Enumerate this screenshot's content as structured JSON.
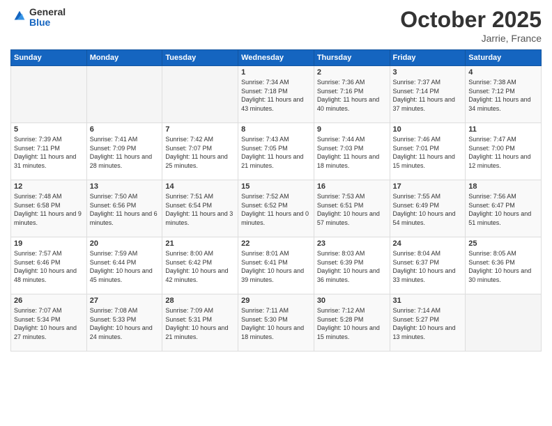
{
  "logo": {
    "line1": "General",
    "line2": "Blue"
  },
  "header": {
    "month": "October 2025",
    "location": "Jarrie, France"
  },
  "weekdays": [
    "Sunday",
    "Monday",
    "Tuesday",
    "Wednesday",
    "Thursday",
    "Friday",
    "Saturday"
  ],
  "weeks": [
    [
      {
        "day": "",
        "info": ""
      },
      {
        "day": "",
        "info": ""
      },
      {
        "day": "",
        "info": ""
      },
      {
        "day": "1",
        "info": "Sunrise: 7:34 AM\nSunset: 7:18 PM\nDaylight: 11 hours\nand 43 minutes."
      },
      {
        "day": "2",
        "info": "Sunrise: 7:36 AM\nSunset: 7:16 PM\nDaylight: 11 hours\nand 40 minutes."
      },
      {
        "day": "3",
        "info": "Sunrise: 7:37 AM\nSunset: 7:14 PM\nDaylight: 11 hours\nand 37 minutes."
      },
      {
        "day": "4",
        "info": "Sunrise: 7:38 AM\nSunset: 7:12 PM\nDaylight: 11 hours\nand 34 minutes."
      }
    ],
    [
      {
        "day": "5",
        "info": "Sunrise: 7:39 AM\nSunset: 7:11 PM\nDaylight: 11 hours\nand 31 minutes."
      },
      {
        "day": "6",
        "info": "Sunrise: 7:41 AM\nSunset: 7:09 PM\nDaylight: 11 hours\nand 28 minutes."
      },
      {
        "day": "7",
        "info": "Sunrise: 7:42 AM\nSunset: 7:07 PM\nDaylight: 11 hours\nand 25 minutes."
      },
      {
        "day": "8",
        "info": "Sunrise: 7:43 AM\nSunset: 7:05 PM\nDaylight: 11 hours\nand 21 minutes."
      },
      {
        "day": "9",
        "info": "Sunrise: 7:44 AM\nSunset: 7:03 PM\nDaylight: 11 hours\nand 18 minutes."
      },
      {
        "day": "10",
        "info": "Sunrise: 7:46 AM\nSunset: 7:01 PM\nDaylight: 11 hours\nand 15 minutes."
      },
      {
        "day": "11",
        "info": "Sunrise: 7:47 AM\nSunset: 7:00 PM\nDaylight: 11 hours\nand 12 minutes."
      }
    ],
    [
      {
        "day": "12",
        "info": "Sunrise: 7:48 AM\nSunset: 6:58 PM\nDaylight: 11 hours\nand 9 minutes."
      },
      {
        "day": "13",
        "info": "Sunrise: 7:50 AM\nSunset: 6:56 PM\nDaylight: 11 hours\nand 6 minutes."
      },
      {
        "day": "14",
        "info": "Sunrise: 7:51 AM\nSunset: 6:54 PM\nDaylight: 11 hours\nand 3 minutes."
      },
      {
        "day": "15",
        "info": "Sunrise: 7:52 AM\nSunset: 6:52 PM\nDaylight: 11 hours\nand 0 minutes."
      },
      {
        "day": "16",
        "info": "Sunrise: 7:53 AM\nSunset: 6:51 PM\nDaylight: 10 hours\nand 57 minutes."
      },
      {
        "day": "17",
        "info": "Sunrise: 7:55 AM\nSunset: 6:49 PM\nDaylight: 10 hours\nand 54 minutes."
      },
      {
        "day": "18",
        "info": "Sunrise: 7:56 AM\nSunset: 6:47 PM\nDaylight: 10 hours\nand 51 minutes."
      }
    ],
    [
      {
        "day": "19",
        "info": "Sunrise: 7:57 AM\nSunset: 6:46 PM\nDaylight: 10 hours\nand 48 minutes."
      },
      {
        "day": "20",
        "info": "Sunrise: 7:59 AM\nSunset: 6:44 PM\nDaylight: 10 hours\nand 45 minutes."
      },
      {
        "day": "21",
        "info": "Sunrise: 8:00 AM\nSunset: 6:42 PM\nDaylight: 10 hours\nand 42 minutes."
      },
      {
        "day": "22",
        "info": "Sunrise: 8:01 AM\nSunset: 6:41 PM\nDaylight: 10 hours\nand 39 minutes."
      },
      {
        "day": "23",
        "info": "Sunrise: 8:03 AM\nSunset: 6:39 PM\nDaylight: 10 hours\nand 36 minutes."
      },
      {
        "day": "24",
        "info": "Sunrise: 8:04 AM\nSunset: 6:37 PM\nDaylight: 10 hours\nand 33 minutes."
      },
      {
        "day": "25",
        "info": "Sunrise: 8:05 AM\nSunset: 6:36 PM\nDaylight: 10 hours\nand 30 minutes."
      }
    ],
    [
      {
        "day": "26",
        "info": "Sunrise: 7:07 AM\nSunset: 5:34 PM\nDaylight: 10 hours\nand 27 minutes."
      },
      {
        "day": "27",
        "info": "Sunrise: 7:08 AM\nSunset: 5:33 PM\nDaylight: 10 hours\nand 24 minutes."
      },
      {
        "day": "28",
        "info": "Sunrise: 7:09 AM\nSunset: 5:31 PM\nDaylight: 10 hours\nand 21 minutes."
      },
      {
        "day": "29",
        "info": "Sunrise: 7:11 AM\nSunset: 5:30 PM\nDaylight: 10 hours\nand 18 minutes."
      },
      {
        "day": "30",
        "info": "Sunrise: 7:12 AM\nSunset: 5:28 PM\nDaylight: 10 hours\nand 15 minutes."
      },
      {
        "day": "31",
        "info": "Sunrise: 7:14 AM\nSunset: 5:27 PM\nDaylight: 10 hours\nand 13 minutes."
      },
      {
        "day": "",
        "info": ""
      }
    ]
  ]
}
